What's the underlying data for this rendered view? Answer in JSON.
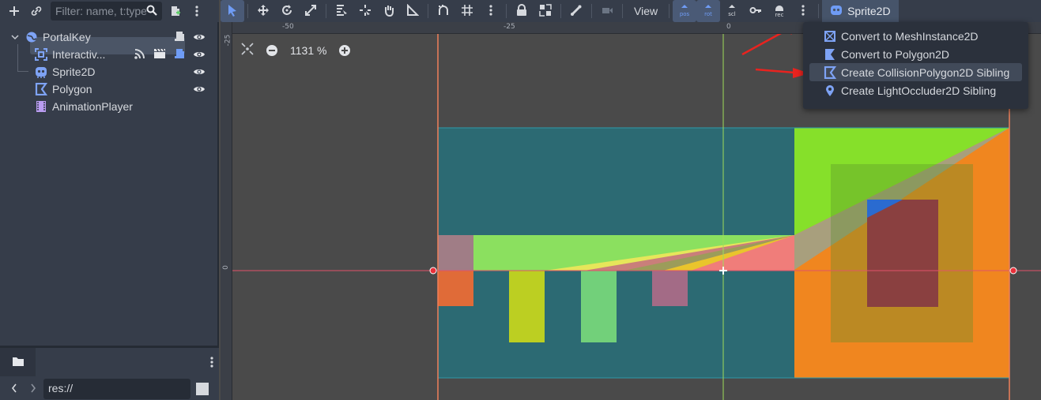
{
  "scene_dock": {
    "filter_placeholder": "Filter: name, t:type",
    "nodes": [
      {
        "label": "PortalKey",
        "icon": "node2d-globe-icon"
      },
      {
        "label": "Interactiv...",
        "icon": "area2d-icon"
      },
      {
        "label": "Sprite2D",
        "icon": "sprite2d-icon",
        "selected": true
      },
      {
        "label": "Polygon",
        "icon": "polygon2d-icon"
      },
      {
        "label": "AnimationPlayer",
        "icon": "animation-player-icon"
      }
    ]
  },
  "filesystem_dock": {
    "path": "res://"
  },
  "main_toolbar": {
    "view_label": "View",
    "sprite_menu_label": "Sprite2D",
    "key_labels": [
      "pos",
      "rot",
      "scl",
      "rec"
    ]
  },
  "viewport": {
    "zoom": "1131 %",
    "ruler_top": [
      "-50",
      "-25",
      "0"
    ],
    "ruler_left": [
      "-25",
      "0"
    ]
  },
  "sprite_menu": {
    "items": [
      {
        "label": "Convert to MeshInstance2D",
        "icon": "mesh-instance2d-icon"
      },
      {
        "label": "Convert to Polygon2D",
        "icon": "polygon2d-icon"
      },
      {
        "label": "Create CollisionPolygon2D Sibling",
        "icon": "collision-polygon2d-icon",
        "hovered": true
      },
      {
        "label": "Create LightOccluder2D Sibling",
        "icon": "light-occluder2d-icon"
      }
    ]
  },
  "colors": {
    "accent": "#6f9cf5",
    "annotation_arrow": "#e8231f",
    "dock_bg": "#363d4a",
    "viewport_bg": "#4a4a4a"
  }
}
